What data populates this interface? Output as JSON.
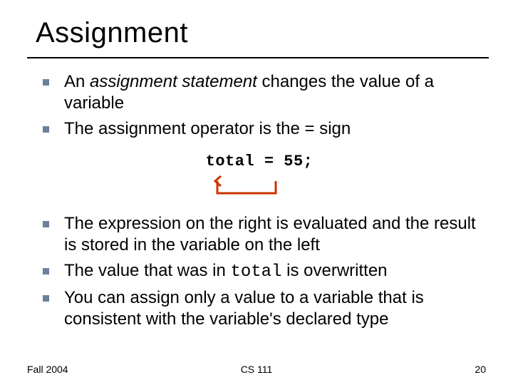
{
  "title": "Assignment",
  "bullets1": {
    "b1_pre": "An ",
    "b1_em": "assignment statement",
    "b1_post": " changes the value of a variable",
    "b2": "The assignment operator is the = sign"
  },
  "code": "total = 55;",
  "bullets2": {
    "b3": "The expression on the right is evaluated and the result is stored in the variable on the left",
    "b4_pre": "The value that was in ",
    "b4_code": "total",
    "b4_post": " is overwritten"
  },
  "bullets3": {
    "b5": "You can assign only a value to a variable that is consistent with the variable's declared type"
  },
  "footer": {
    "left": "Fall 2004",
    "center": "CS 111",
    "right": "20"
  }
}
